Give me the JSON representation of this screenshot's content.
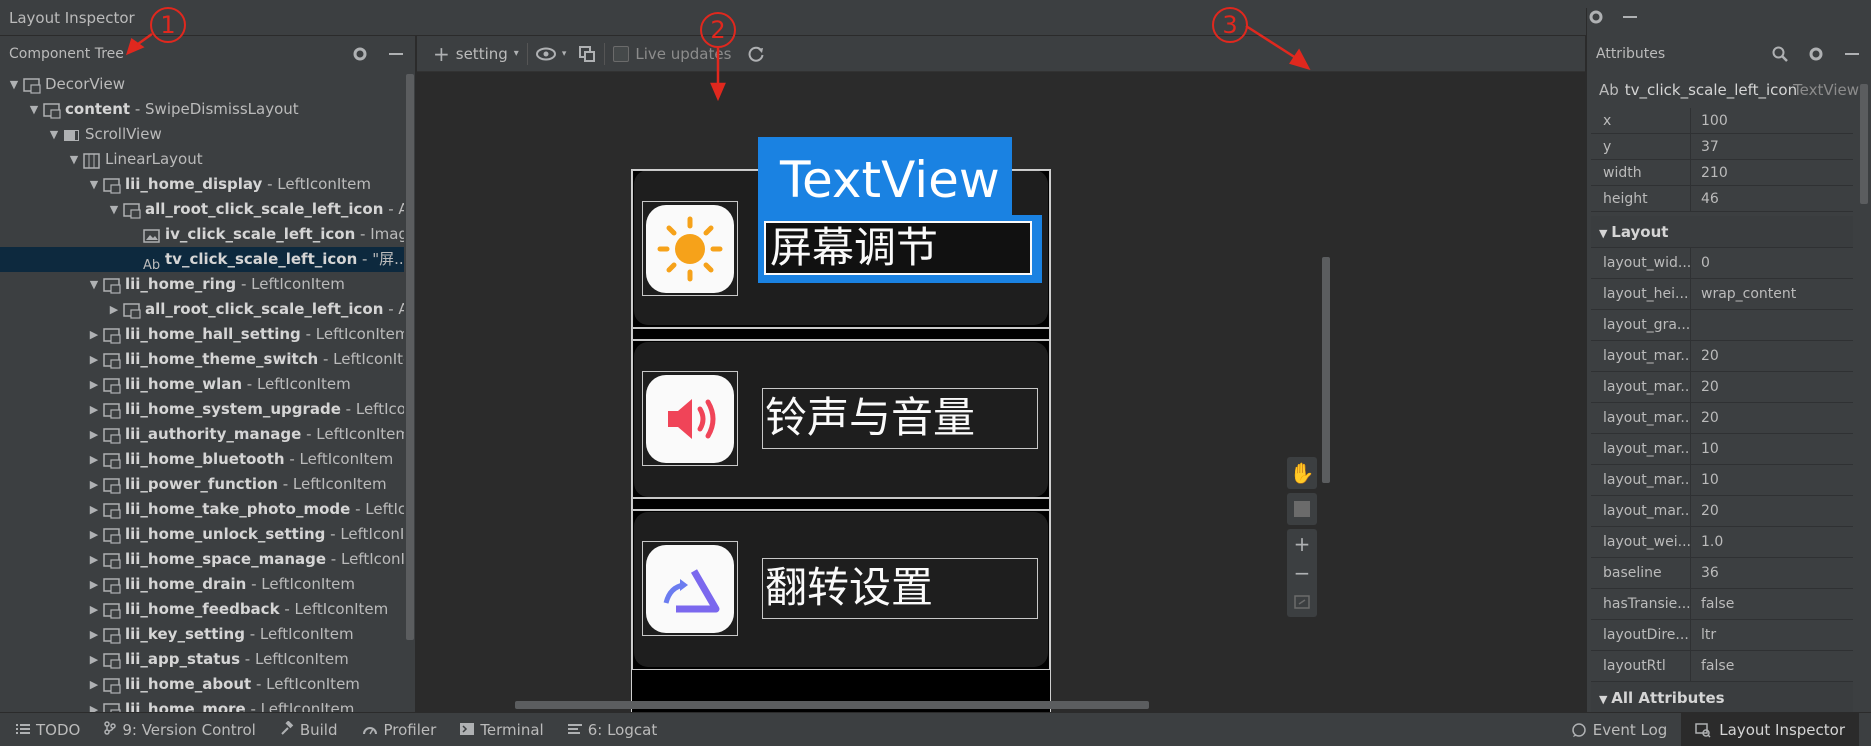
{
  "window": {
    "title": "Layout Inspector"
  },
  "component_tree": {
    "header": "Component Tree",
    "rows": [
      {
        "indent": 0,
        "arrow": "▼",
        "icon": "viewgroup-icon",
        "name": "DecorView",
        "suffix": "",
        "bold": false
      },
      {
        "indent": 1,
        "arrow": "▼",
        "icon": "viewgroup-icon",
        "name": "content",
        "suffix": " - SwipeDismissLayout",
        "bold": true
      },
      {
        "indent": 2,
        "arrow": "▼",
        "icon": "scrollview-icon",
        "name": "ScrollView",
        "suffix": "",
        "bold": false
      },
      {
        "indent": 3,
        "arrow": "▼",
        "icon": "linearlayout-icon",
        "name": "LinearLayout",
        "suffix": "",
        "bold": false
      },
      {
        "indent": 4,
        "arrow": "▼",
        "icon": "viewgroup-icon",
        "name": "lii_home_display",
        "suffix": " - LeftIconItem",
        "bold": true
      },
      {
        "indent": 5,
        "arrow": "▼",
        "icon": "viewgroup-icon",
        "name": "all_root_click_scale_left_icon",
        "suffix": " - A...",
        "bold": true
      },
      {
        "indent": 6,
        "arrow": "",
        "icon": "image-icon",
        "name": "iv_click_scale_left_icon",
        "suffix": " - Imag...",
        "bold": true
      },
      {
        "indent": 6,
        "arrow": "",
        "icon": "textview-icon",
        "name": "tv_click_scale_left_icon",
        "suffix": " - \"屏...",
        "bold": true,
        "selected": true
      },
      {
        "indent": 4,
        "arrow": "▼",
        "icon": "viewgroup-icon",
        "name": "lii_home_ring",
        "suffix": " - LeftIconItem",
        "bold": true
      },
      {
        "indent": 5,
        "arrow": "▶",
        "icon": "viewgroup-icon",
        "name": "all_root_click_scale_left_icon",
        "suffix": " - A...",
        "bold": true
      },
      {
        "indent": 4,
        "arrow": "▶",
        "icon": "viewgroup-icon",
        "name": "lii_home_hall_setting",
        "suffix": " - LeftIconItem",
        "bold": true
      },
      {
        "indent": 4,
        "arrow": "▶",
        "icon": "viewgroup-icon",
        "name": "lii_home_theme_switch",
        "suffix": " - LeftIconIte...",
        "bold": true
      },
      {
        "indent": 4,
        "arrow": "▶",
        "icon": "viewgroup-icon",
        "name": "lii_home_wlan",
        "suffix": " - LeftIconItem",
        "bold": true
      },
      {
        "indent": 4,
        "arrow": "▶",
        "icon": "viewgroup-icon",
        "name": "lii_home_system_upgrade",
        "suffix": " - LeftIcon...",
        "bold": true
      },
      {
        "indent": 4,
        "arrow": "▶",
        "icon": "viewgroup-icon",
        "name": "lii_authority_manage",
        "suffix": " - LeftIconItem",
        "bold": true
      },
      {
        "indent": 4,
        "arrow": "▶",
        "icon": "viewgroup-icon",
        "name": "lii_home_bluetooth",
        "suffix": " - LeftIconItem",
        "bold": true
      },
      {
        "indent": 4,
        "arrow": "▶",
        "icon": "viewgroup-icon",
        "name": "lii_power_function",
        "suffix": " - LeftIconItem",
        "bold": true
      },
      {
        "indent": 4,
        "arrow": "▶",
        "icon": "viewgroup-icon",
        "name": "lii_home_take_photo_mode",
        "suffix": " - LeftIco...",
        "bold": true
      },
      {
        "indent": 4,
        "arrow": "▶",
        "icon": "viewgroup-icon",
        "name": "lii_home_unlock_setting",
        "suffix": " - LeftIconIt...",
        "bold": true
      },
      {
        "indent": 4,
        "arrow": "▶",
        "icon": "viewgroup-icon",
        "name": "lii_home_space_manage",
        "suffix": " - LeftIconIt...",
        "bold": true
      },
      {
        "indent": 4,
        "arrow": "▶",
        "icon": "viewgroup-icon",
        "name": "lii_home_drain",
        "suffix": " - LeftIconItem",
        "bold": true
      },
      {
        "indent": 4,
        "arrow": "▶",
        "icon": "viewgroup-icon",
        "name": "lii_home_feedback",
        "suffix": " - LeftIconItem",
        "bold": true
      },
      {
        "indent": 4,
        "arrow": "▶",
        "icon": "viewgroup-icon",
        "name": "lii_key_setting",
        "suffix": " - LeftIconItem",
        "bold": true
      },
      {
        "indent": 4,
        "arrow": "▶",
        "icon": "viewgroup-icon",
        "name": "lii_app_status",
        "suffix": " - LeftIconItem",
        "bold": true
      },
      {
        "indent": 4,
        "arrow": "▶",
        "icon": "viewgroup-icon",
        "name": "lii_home_about",
        "suffix": " - LeftIconItem",
        "bold": true
      },
      {
        "indent": 4,
        "arrow": "▶",
        "icon": "viewgroup-icon",
        "name": "lii_home_more",
        "suffix": " - LeftIconItem",
        "bold": true
      }
    ]
  },
  "toolbar": {
    "device_label": "setting",
    "live_updates_label": "Live updates",
    "live_updates_checked": false
  },
  "preview": {
    "selected_view_label": "TextView",
    "items": [
      {
        "text": "屏幕调节",
        "icon": "brightness-icon"
      },
      {
        "text": "铃声与音量",
        "icon": "volume-icon"
      },
      {
        "text": "翻转设置",
        "icon": "flip-icon"
      }
    ]
  },
  "attributes": {
    "header": "Attributes",
    "selected_id": "tv_click_scale_left_icon",
    "selected_type": "TextView",
    "selected_prefix": "Ab",
    "dimensions": [
      {
        "key": "x",
        "value": "100"
      },
      {
        "key": "y",
        "value": "37"
      },
      {
        "key": "width",
        "value": "210"
      },
      {
        "key": "height",
        "value": "46"
      }
    ],
    "layout_section": "Layout",
    "layout": [
      {
        "key": "layout_wid...",
        "value": "0"
      },
      {
        "key": "layout_hei...",
        "value": "wrap_content"
      },
      {
        "key": "layout_gra...",
        "value": ""
      },
      {
        "key": "layout_mar...",
        "value": "20"
      },
      {
        "key": "layout_mar...",
        "value": "20"
      },
      {
        "key": "layout_mar...",
        "value": "20"
      },
      {
        "key": "layout_mar...",
        "value": "10"
      },
      {
        "key": "layout_mar...",
        "value": "10"
      },
      {
        "key": "layout_mar...",
        "value": "20"
      },
      {
        "key": "layout_wei...",
        "value": "1.0"
      },
      {
        "key": "baseline",
        "value": "36"
      },
      {
        "key": "hasTransie...",
        "value": "false"
      },
      {
        "key": "layoutDire...",
        "value": "ltr"
      },
      {
        "key": "layoutRtl",
        "value": "false"
      }
    ],
    "all_section": "All Attributes"
  },
  "statusbar": {
    "left": [
      {
        "label": "TODO",
        "icon": "list-icon"
      },
      {
        "label": "9: Version Control",
        "icon": "vcs-icon"
      },
      {
        "label": "Build",
        "icon": "hammer-icon"
      },
      {
        "label": "Profiler",
        "icon": "gauge-icon"
      },
      {
        "label": "Terminal",
        "icon": "terminal-icon"
      },
      {
        "label": "6: Logcat",
        "icon": "logcat-icon"
      }
    ],
    "event_log": "Event Log",
    "layout_inspector": "Layout Inspector"
  },
  "annotations": [
    "1",
    "2",
    "3"
  ],
  "colors": {
    "accent": "#1a82e2",
    "annotation": "#e0281e",
    "selection": "#0d293e"
  }
}
